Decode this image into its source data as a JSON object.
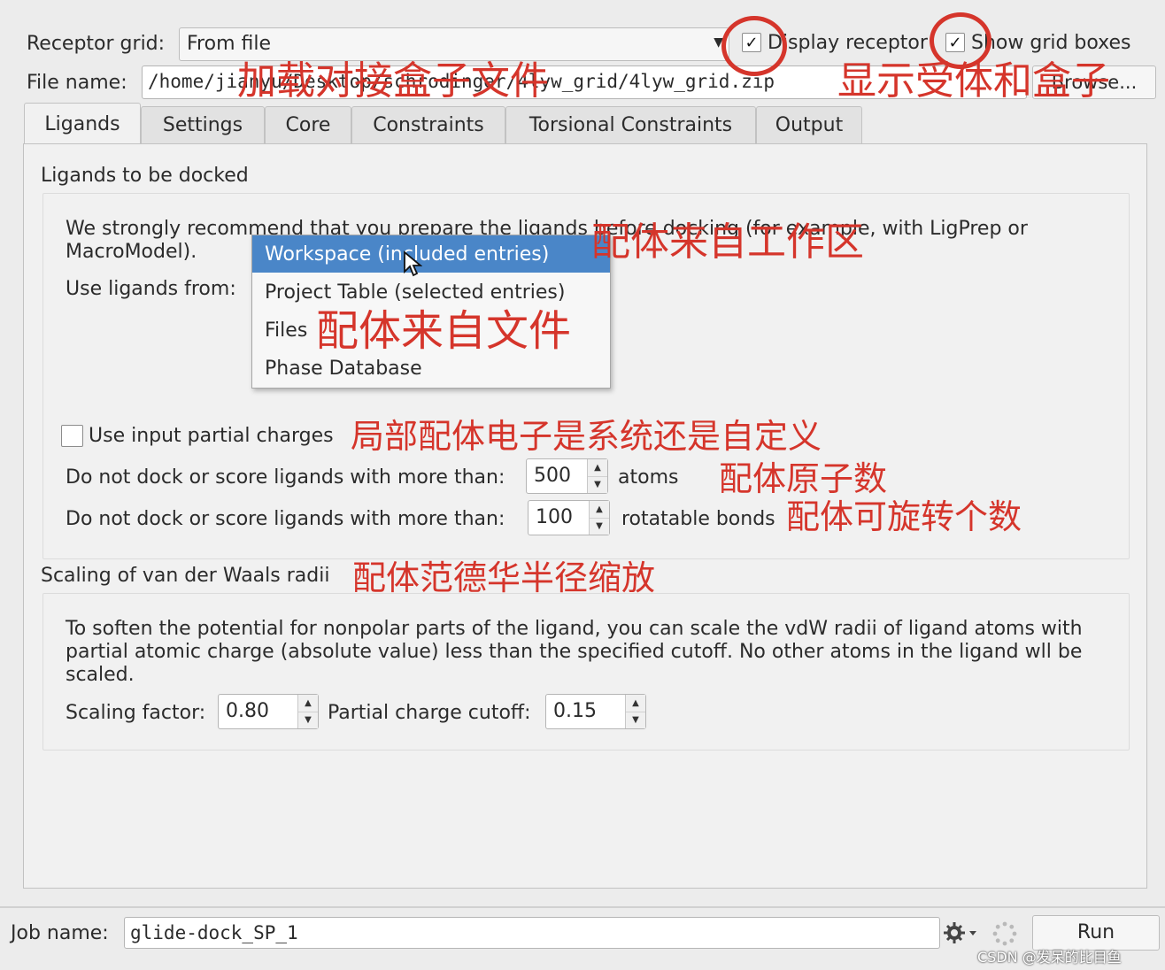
{
  "top": {
    "receptor_grid_label": "Receptor grid:",
    "receptor_grid_value": "From file",
    "display_receptor_label": "Display receptor",
    "display_receptor_checked": true,
    "show_grid_boxes_label": "Show grid boxes",
    "show_grid_boxes_checked": true,
    "file_name_label": "File name:",
    "file_name_value": "/home/jianyu/Desktop/schrodinger/4lyw_grid/4lyw_grid.zip",
    "browse_label": "Browse..."
  },
  "tabs": [
    {
      "label": "Ligands",
      "active": true
    },
    {
      "label": "Settings",
      "active": false
    },
    {
      "label": "Core",
      "active": false
    },
    {
      "label": "Constraints",
      "active": false
    },
    {
      "label": "Torsional Constraints",
      "active": false
    },
    {
      "label": "Output",
      "active": false
    }
  ],
  "ligands": {
    "section_title": "Ligands to be docked",
    "recommend_line1": "We strongly recommend that you prepare the ligands before docking (for example, with LigPrep or",
    "recommend_line2": "MacroModel).",
    "use_ligands_from_label": "Use ligands from:",
    "dropdown_options": [
      {
        "label": "Workspace (included entries)",
        "highlighted": true
      },
      {
        "label": "Project Table (selected entries)",
        "highlighted": false
      },
      {
        "label": "Files",
        "highlighted": false
      },
      {
        "label": "Phase Database",
        "highlighted": false
      }
    ],
    "partial_charges_label": "Use input partial charges",
    "partial_charges_checked": false,
    "max_atoms_prefix": "Do not dock or score ligands with more than:",
    "max_atoms_value": "500",
    "max_atoms_suffix": "atoms",
    "max_rotbonds_prefix": "Do not dock or score ligands with more than:",
    "max_rotbonds_value": "100",
    "max_rotbonds_suffix": "rotatable bonds"
  },
  "vdw": {
    "section_title": "Scaling of van der Waals radii",
    "desc_line1": "To soften the potential for nonpolar parts of the ligand, you can scale the vdW radii of ligand atoms with",
    "desc_line2": "partial atomic charge (absolute value) less than the specified cutoff. No other atoms in the ligand wll be",
    "desc_line3": "scaled.",
    "scaling_factor_label": "Scaling factor:",
    "scaling_factor_value": "0.80",
    "partial_charge_cutoff_label": "Partial charge cutoff:",
    "partial_charge_cutoff_value": "0.15"
  },
  "footer": {
    "job_name_label": "Job name:",
    "job_name_value": "glide-dock_SP_1",
    "run_label": "Run",
    "watermark": "CSDN @发呆的比目鱼"
  },
  "annotations": {
    "load_grid": "加载对接盒子文件",
    "show_receptor_box": "显示受体和盒子",
    "ligand_from_workspace": "配体来自工作区",
    "ligand_from_file": "配体来自文件",
    "partial_charge": "局部配体电子是系统还是自定义",
    "atom_count": "配体原子数",
    "rot_count": "配体可旋转个数",
    "vdw_scale": "配体范德华半径缩放"
  },
  "colors": {
    "annotation_red": "#d5352b",
    "menu_highlight": "#4a86c8"
  },
  "icons": [
    "dropdown-arrow-icon",
    "checkmark-icon",
    "spin-up-icon",
    "spin-down-icon",
    "gear-icon",
    "spinner-icon",
    "mouse-cursor-icon"
  ]
}
